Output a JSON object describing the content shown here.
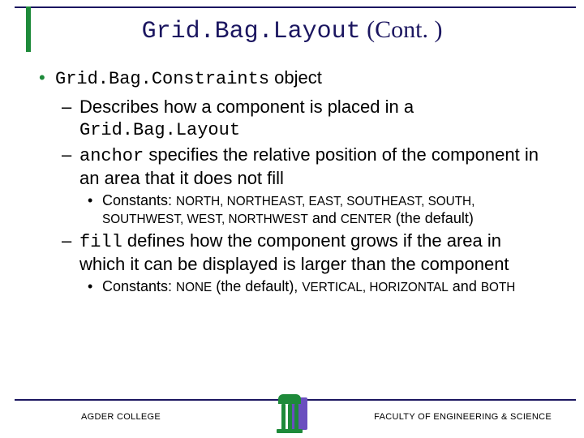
{
  "title": {
    "code": "Grid.Bag.Layout",
    "suffix": "(Cont. )"
  },
  "bullets": {
    "b1_code": "Grid.Bag.Constraints",
    "b1_tail": " object",
    "b2a": "Describes how a component is placed in a ",
    "b2a_code": "Grid.Bag.Layout",
    "b2b_code": "anchor",
    "b2b_tail": " specifies the relative position of the component in an area that it does not fill",
    "b3a_lead": "Constants: ",
    "b3a_codes": "NORTH, NORTHEAST, EAST, SOUTHEAST, SOUTH, SOUTHWEST, WEST, NORTHWEST",
    "b3a_mid": " and ",
    "b3a_code2": "CENTER",
    "b3a_tail": " (the default)",
    "b2c_code": "fill",
    "b2c_tail": " defines how the component grows if the area in which it can be displayed is larger than the component",
    "b3b_lead": "Constants: ",
    "b3b_code1": "NONE",
    "b3b_mid1": " (the default), ",
    "b3b_code2": "VERTICAL, HORIZONTAL",
    "b3b_mid2": " and ",
    "b3b_code3": "BOTH"
  },
  "footer": {
    "left": "AGDER COLLEGE",
    "right": "FACULTY OF ENGINEERING & SCIENCE"
  }
}
